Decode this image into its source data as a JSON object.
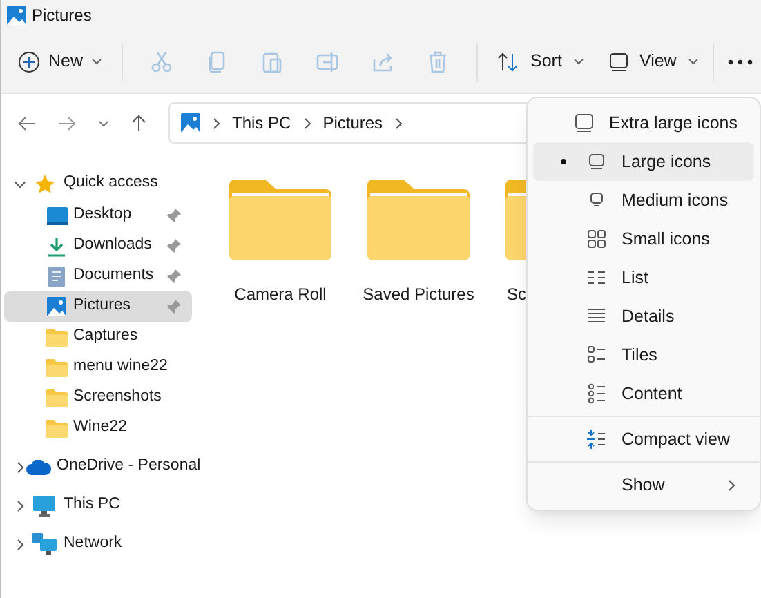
{
  "window": {
    "title": "Pictures"
  },
  "toolbar": {
    "new": {
      "label": "New"
    },
    "actions": [
      {
        "kind": "cut",
        "disabled": true
      },
      {
        "kind": "copy",
        "disabled": true
      },
      {
        "kind": "paste",
        "disabled": true
      },
      {
        "kind": "rename",
        "disabled": true
      },
      {
        "kind": "share",
        "disabled": true
      },
      {
        "kind": "delete",
        "disabled": true
      }
    ],
    "sort": {
      "label": "Sort"
    },
    "view": {
      "label": "View"
    }
  },
  "breadcrumb": [
    "This PC",
    "Pictures"
  ],
  "sidebar": {
    "items": [
      {
        "label": "Quick access",
        "expanded": true,
        "selected": false,
        "children": [
          {
            "label": "Desktop",
            "pinned": true,
            "selected": false
          },
          {
            "label": "Downloads",
            "pinned": true,
            "selected": false
          },
          {
            "label": "Documents",
            "pinned": true,
            "selected": false
          },
          {
            "label": "Pictures",
            "pinned": true,
            "selected": true
          },
          {
            "label": "Captures",
            "pinned": false,
            "selected": false
          },
          {
            "label": "menu wine22",
            "pinned": false,
            "selected": false
          },
          {
            "label": "Screenshots",
            "pinned": false,
            "selected": false
          },
          {
            "label": "Wine22",
            "pinned": false,
            "selected": false
          }
        ]
      },
      {
        "label": "OneDrive - Personal",
        "expanded": false,
        "selected": false
      },
      {
        "label": "This PC",
        "expanded": false,
        "selected": false
      },
      {
        "label": "Network",
        "expanded": false,
        "selected": false
      }
    ]
  },
  "folders": [
    {
      "name": "Camera Roll"
    },
    {
      "name": "Saved Pictures"
    },
    {
      "name": "Sc"
    }
  ],
  "view_menu": {
    "items": [
      {
        "kind": "option",
        "label": "Extra large icons",
        "selected": false
      },
      {
        "kind": "option",
        "label": "Large icons",
        "selected": true
      },
      {
        "kind": "option",
        "label": "Medium icons",
        "selected": false
      },
      {
        "kind": "option",
        "label": "Small icons",
        "selected": false
      },
      {
        "kind": "option",
        "label": "List",
        "selected": false
      },
      {
        "kind": "option",
        "label": "Details",
        "selected": false
      },
      {
        "kind": "option",
        "label": "Tiles",
        "selected": false
      },
      {
        "kind": "option",
        "label": "Content",
        "selected": false
      },
      {
        "kind": "toggle",
        "label": "Compact view"
      },
      {
        "kind": "submenu",
        "label": "Show"
      }
    ]
  }
}
